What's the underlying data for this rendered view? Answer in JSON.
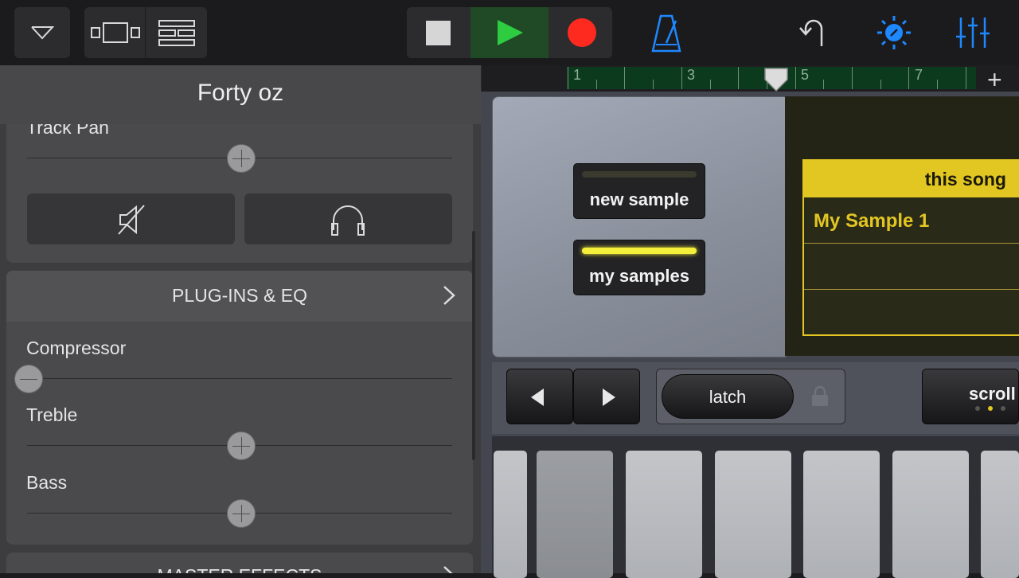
{
  "toolbar": {
    "buttons": {
      "browser": "chevron-down-icon",
      "tracks_view": "tracks-view-icon",
      "instrument_view": "grid-view-icon",
      "stop": "stop-icon",
      "play": "play-icon",
      "record": "record-icon",
      "metronome": "metronome-icon",
      "undo": "undo-icon",
      "settings": "settings-icon",
      "mixer": "mixer-icon"
    }
  },
  "ruler": {
    "numbers": [
      "1",
      "3",
      "5",
      "7"
    ],
    "add": "+"
  },
  "panel": {
    "title": "Forty oz",
    "track_pan_label": "Track Pan",
    "plugins_eq_label": "PLUG-INS & EQ",
    "compressor_label": "Compressor",
    "treble_label": "Treble",
    "bass_label": "Bass",
    "master_effects_label": "MASTER EFFECTS",
    "levels": {
      "track_pan": 0.5,
      "compressor": 0.0,
      "treble": 0.5,
      "bass": 0.5
    }
  },
  "sampler": {
    "new_sample": "new sample",
    "my_samples": "my samples",
    "tab": "this song",
    "samples": [
      "My Sample 1"
    ],
    "latch": "latch",
    "scroll": "scroll"
  },
  "colors": {
    "accent_yellow": "#e2c622",
    "play_green": "#2ecc40",
    "record_red": "#ff2a1f",
    "blue": "#1e88ff"
  }
}
